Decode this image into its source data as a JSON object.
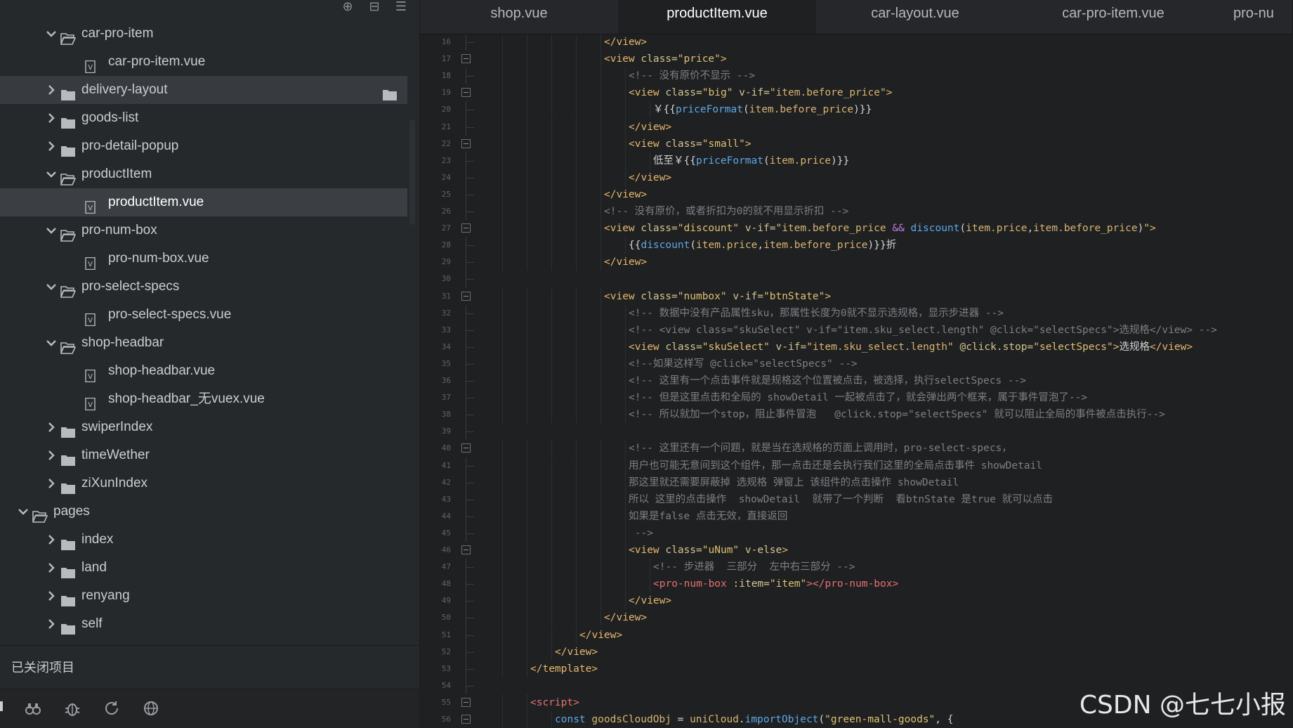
{
  "sidebar": {
    "toolbar": [
      "target-icon",
      "collapse-all-icon",
      "menu-icon"
    ],
    "tree": [
      {
        "label": "car-pro-item",
        "type": "folder",
        "expanded": true
      },
      {
        "label": "car-pro-item.vue",
        "type": "file"
      },
      {
        "label": "delivery-layout",
        "type": "folder",
        "expanded": false
      },
      {
        "label": "goods-list",
        "type": "folder",
        "expanded": false
      },
      {
        "label": "pro-detail-popup",
        "type": "folder",
        "expanded": false
      },
      {
        "label": "productItem",
        "type": "folder",
        "expanded": true
      },
      {
        "label": "productItem.vue",
        "type": "file"
      },
      {
        "label": "pro-num-box",
        "type": "folder",
        "expanded": true
      },
      {
        "label": "pro-num-box.vue",
        "type": "file"
      },
      {
        "label": "pro-select-specs",
        "type": "folder",
        "expanded": true
      },
      {
        "label": "pro-select-specs.vue",
        "type": "file"
      },
      {
        "label": "shop-headbar",
        "type": "folder",
        "expanded": true
      },
      {
        "label": "shop-headbar.vue",
        "type": "file"
      },
      {
        "label": "shop-headbar_无vuex.vue",
        "type": "file"
      },
      {
        "label": "swiperIndex",
        "type": "folder",
        "expanded": false
      },
      {
        "label": "timeWether",
        "type": "folder",
        "expanded": false
      },
      {
        "label": "ziXunIndex",
        "type": "folder",
        "expanded": false
      },
      {
        "label": "pages",
        "type": "folder",
        "expanded": true
      },
      {
        "label": "index",
        "type": "folder",
        "expanded": false
      },
      {
        "label": "land",
        "type": "folder",
        "expanded": false
      },
      {
        "label": "renyang",
        "type": "folder",
        "expanded": false
      },
      {
        "label": "self",
        "type": "folder",
        "expanded": false
      }
    ],
    "closed_projects": "已关闭项目",
    "bottom_icons": [
      "binoculars-icon",
      "bug-icon",
      "refresh-icon",
      "globe-icon"
    ]
  },
  "tabs": [
    {
      "label": "shop.vue",
      "active": false
    },
    {
      "label": "productItem.vue",
      "active": true
    },
    {
      "label": "car-layout.vue",
      "active": false
    },
    {
      "label": "car-pro-item.vue",
      "active": false
    },
    {
      "label": "pro-nu",
      "active": false
    }
  ],
  "editor": {
    "lines": [
      {
        "n": "16",
        "fold": false,
        "tokens": [
          [
            "tag",
            "</view>"
          ]
        ]
      },
      {
        "n": "17",
        "fold": true,
        "tokens": [
          [
            "tag",
            "<view "
          ],
          [
            "attr",
            "class="
          ],
          [
            "str",
            "\"price\""
          ],
          [
            "tag",
            ">"
          ]
        ]
      },
      {
        "n": "18",
        "fold": false,
        "tokens": [
          [
            "cm",
            "<!-- 没有原价不显示 -->"
          ]
        ]
      },
      {
        "n": "19",
        "fold": true,
        "tokens": [
          [
            "tag",
            "<view "
          ],
          [
            "attr",
            "class="
          ],
          [
            "str",
            "\"big\" "
          ],
          [
            "attr",
            "v-if="
          ],
          [
            "str",
            "\""
          ],
          [
            "var",
            "item.before_price"
          ],
          [
            "str",
            "\""
          ],
          [
            "tag",
            ">"
          ]
        ]
      },
      {
        "n": "20",
        "fold": false,
        "tokens": [
          [
            "txt",
            "￥{{"
          ],
          [
            "fn",
            "priceFormat"
          ],
          [
            "txt",
            "("
          ],
          [
            "var",
            "item.before_price"
          ],
          [
            "txt",
            ")}}"
          ]
        ]
      },
      {
        "n": "21",
        "fold": false,
        "tokens": [
          [
            "tag",
            "</view>"
          ]
        ]
      },
      {
        "n": "22",
        "fold": true,
        "tokens": [
          [
            "tag",
            "<view "
          ],
          [
            "attr",
            "class="
          ],
          [
            "str",
            "\"small\""
          ],
          [
            "tag",
            ">"
          ]
        ]
      },
      {
        "n": "23",
        "fold": false,
        "tokens": [
          [
            "txt",
            "低至￥{{"
          ],
          [
            "fn",
            "priceFormat"
          ],
          [
            "txt",
            "("
          ],
          [
            "var",
            "item.price"
          ],
          [
            "txt",
            ")}}"
          ]
        ]
      },
      {
        "n": "24",
        "fold": false,
        "tokens": [
          [
            "tag",
            "</view>"
          ]
        ]
      },
      {
        "n": "25",
        "fold": false,
        "tokens": [
          [
            "tag",
            "</view>"
          ]
        ]
      },
      {
        "n": "26",
        "fold": false,
        "tokens": [
          [
            "cm",
            "<!-- 没有原价，或者折扣为0的就不用显示折扣 -->"
          ]
        ]
      },
      {
        "n": "27",
        "fold": true,
        "tokens": [
          [
            "tag",
            "<view "
          ],
          [
            "attr",
            "class="
          ],
          [
            "str",
            "\"discount\" "
          ],
          [
            "attr",
            "v-if="
          ],
          [
            "str",
            "\""
          ],
          [
            "var",
            "item.before_price "
          ],
          [
            "op",
            "&& "
          ],
          [
            "fn",
            "discount"
          ],
          [
            "txt",
            "("
          ],
          [
            "var",
            "item.price"
          ],
          [
            "txt",
            ","
          ],
          [
            "var",
            "item.before_price"
          ],
          [
            "txt",
            ")"
          ],
          [
            "str",
            "\""
          ],
          [
            "tag",
            ">"
          ]
        ]
      },
      {
        "n": "28",
        "fold": false,
        "tokens": [
          [
            "txt",
            "{{"
          ],
          [
            "fn",
            "discount"
          ],
          [
            "txt",
            "("
          ],
          [
            "var",
            "item.price"
          ],
          [
            "txt",
            ","
          ],
          [
            "var",
            "item.before_price"
          ],
          [
            "txt",
            ")}}折"
          ]
        ]
      },
      {
        "n": "29",
        "fold": false,
        "tokens": [
          [
            "tag",
            "</view>"
          ]
        ]
      },
      {
        "n": "30",
        "fold": false,
        "tokens": []
      },
      {
        "n": "31",
        "fold": true,
        "tokens": [
          [
            "tag",
            "<view "
          ],
          [
            "attr",
            "class="
          ],
          [
            "str",
            "\"numbox\" "
          ],
          [
            "attr",
            "v-if="
          ],
          [
            "str",
            "\"btnState\""
          ],
          [
            "tag",
            ">"
          ]
        ]
      },
      {
        "n": "32",
        "fold": false,
        "tokens": [
          [
            "cm",
            "<!-- 数据中没有产品属性sku，那属性长度为0就不显示选规格，显示步进器 -->"
          ]
        ]
      },
      {
        "n": "33",
        "fold": false,
        "tokens": [
          [
            "cm",
            "<!-- <view class=\"skuSelect\" v-if=\"item.sku_select.length\" @click=\"selectSpecs\">选规格</view> -->"
          ]
        ]
      },
      {
        "n": "34",
        "fold": false,
        "tokens": [
          [
            "tag",
            "<view "
          ],
          [
            "attr",
            "class="
          ],
          [
            "str",
            "\"skuSelect\" "
          ],
          [
            "attr",
            "v-if="
          ],
          [
            "str",
            "\""
          ],
          [
            "var",
            "item.sku_select.length"
          ],
          [
            "str",
            "\" "
          ],
          [
            "attr",
            "@click.stop="
          ],
          [
            "str",
            "\"selectSpecs\""
          ],
          [
            "tag",
            ">"
          ],
          [
            "txt",
            "选规格"
          ],
          [
            "tag",
            "</view>"
          ]
        ]
      },
      {
        "n": "35",
        "fold": false,
        "tokens": [
          [
            "cm",
            "<!--如果这样写 @click=\"selectSpecs\" -->"
          ]
        ]
      },
      {
        "n": "36",
        "fold": false,
        "tokens": [
          [
            "cm",
            "<!-- 这里有一个点击事件就是规格这个位置被点击，被选择，执行selectSpecs -->"
          ]
        ]
      },
      {
        "n": "37",
        "fold": false,
        "tokens": [
          [
            "cm",
            "<!-- 但是这里点击和全局的 showDetail 一起被点击了，就会弹出两个框来，属于事件冒泡了-->"
          ]
        ]
      },
      {
        "n": "38",
        "fold": false,
        "tokens": [
          [
            "cm",
            "<!-- 所以就加一个stop，阻止事件冒泡   @click.stop=\"selectSpecs\" 就可以阻止全局的事件被点击执行-->"
          ]
        ]
      },
      {
        "n": "39",
        "fold": false,
        "tokens": []
      },
      {
        "n": "40",
        "fold": true,
        "tokens": [
          [
            "cm",
            "<!-- 这里还有一个问题，就是当在选规格的页面上调用时，pro-select-specs，"
          ]
        ]
      },
      {
        "n": "41",
        "fold": false,
        "tokens": [
          [
            "cm",
            "用户也可能无意间到这个组件，那一点击还是会执行我们这里的全局点击事件 showDetail"
          ]
        ]
      },
      {
        "n": "42",
        "fold": false,
        "tokens": [
          [
            "cm",
            "那这里就还需要屏蔽掉 选规格 弹窗上 该组件的点击操作 showDetail"
          ]
        ]
      },
      {
        "n": "43",
        "fold": false,
        "tokens": [
          [
            "cm",
            "所以 这里的点击操作  showDetail  就带了一个判断  看btnState 是true 就可以点击"
          ]
        ]
      },
      {
        "n": "44",
        "fold": false,
        "tokens": [
          [
            "cm",
            "如果是false 点击无效，直接返回"
          ]
        ]
      },
      {
        "n": "45",
        "fold": false,
        "tokens": [
          [
            "cm",
            " -->"
          ]
        ]
      },
      {
        "n": "46",
        "fold": true,
        "tokens": [
          [
            "tag",
            "<view "
          ],
          [
            "attr",
            "class="
          ],
          [
            "str",
            "\"uNum\" "
          ],
          [
            "attr",
            "v-else"
          ],
          [
            "tag",
            ">"
          ]
        ]
      },
      {
        "n": "47",
        "fold": false,
        "tokens": [
          [
            "cm",
            "<!-- 步进器  三部分  左中右三部分 -->"
          ]
        ]
      },
      {
        "n": "48",
        "fold": false,
        "tokens": [
          [
            "red",
            "<pro-num-box "
          ],
          [
            "attr",
            ":item="
          ],
          [
            "str",
            "\"item\""
          ],
          [
            "red",
            "></pro-num-box>"
          ]
        ]
      },
      {
        "n": "49",
        "fold": false,
        "tokens": [
          [
            "tag",
            "</view>"
          ]
        ]
      },
      {
        "n": "50",
        "fold": false,
        "tokens": [
          [
            "tag",
            "</view>"
          ]
        ]
      },
      {
        "n": "51",
        "fold": false,
        "tokens": [
          [
            "tag",
            "</view>"
          ]
        ]
      },
      {
        "n": "52",
        "fold": false,
        "tokens": [
          [
            "tag",
            "</view>"
          ]
        ]
      },
      {
        "n": "53",
        "fold": false,
        "tokens": [
          [
            "tag",
            "</template>"
          ]
        ]
      },
      {
        "n": "54",
        "fold": false,
        "tokens": []
      },
      {
        "n": "55",
        "fold": true,
        "tokens": [
          [
            "red",
            "<script>"
          ]
        ]
      },
      {
        "n": "56",
        "fold": true,
        "tokens": [
          [
            "kw",
            "const "
          ],
          [
            "var",
            "goodsCloudObj "
          ],
          [
            "txt",
            "= "
          ],
          [
            "var",
            "uniCloud"
          ],
          [
            "txt",
            "."
          ],
          [
            "fn",
            "importObject"
          ],
          [
            "txt",
            "("
          ],
          [
            "str",
            "\"green-mall-goods\""
          ],
          [
            "txt",
            ", {"
          ]
        ]
      }
    ]
  },
  "watermark": "CSDN @七七小报"
}
